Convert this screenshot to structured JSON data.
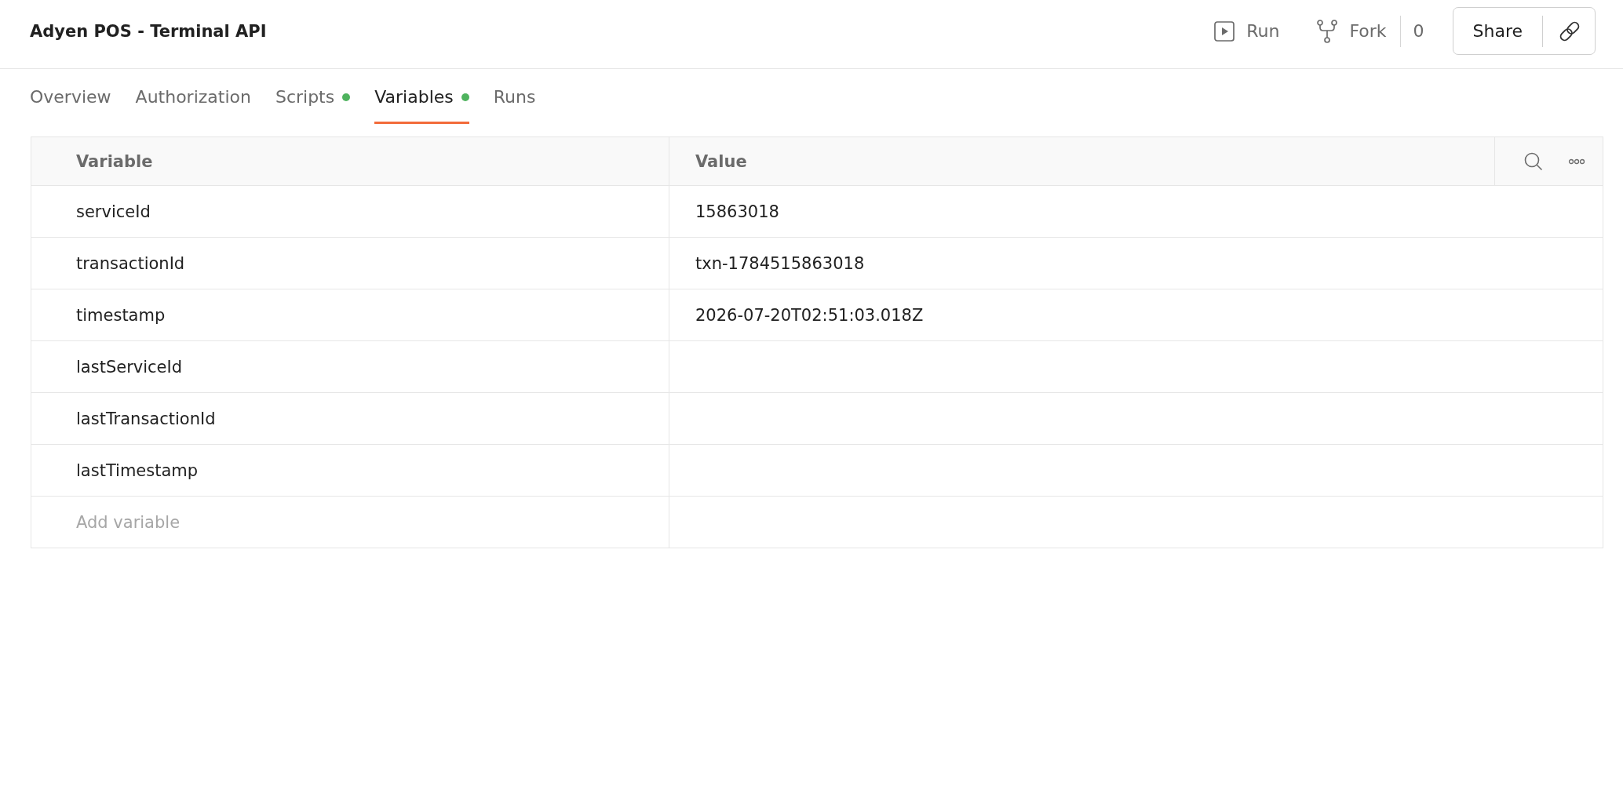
{
  "header": {
    "title": "Adyen POS - Terminal API",
    "actions": [
      {
        "kind": "run",
        "label": "Run"
      },
      {
        "kind": "fork",
        "label": "Fork",
        "count": "0"
      }
    ],
    "share": {
      "label": "Share"
    }
  },
  "tabs": [
    {
      "label": "Overview",
      "selected": false,
      "dot": false
    },
    {
      "label": "Authorization",
      "selected": false,
      "dot": false
    },
    {
      "label": "Scripts",
      "selected": false,
      "dot": true
    },
    {
      "label": "Variables",
      "selected": true,
      "dot": true
    },
    {
      "label": "Runs",
      "selected": false,
      "dot": false
    }
  ],
  "table": {
    "columns": [
      "Variable",
      "Value"
    ],
    "rows": [
      {
        "variable": "serviceId",
        "value": "15863018"
      },
      {
        "variable": "transactionId",
        "value": "txn-1784515863018"
      },
      {
        "variable": "timestamp",
        "value": "2026-07-20T02:51:03.018Z"
      },
      {
        "variable": "lastServiceId"
      },
      {
        "variable": "lastTransactionId"
      },
      {
        "variable": "lastTimestamp"
      }
    ],
    "new_row": {
      "placeholder": "Add variable"
    }
  }
}
